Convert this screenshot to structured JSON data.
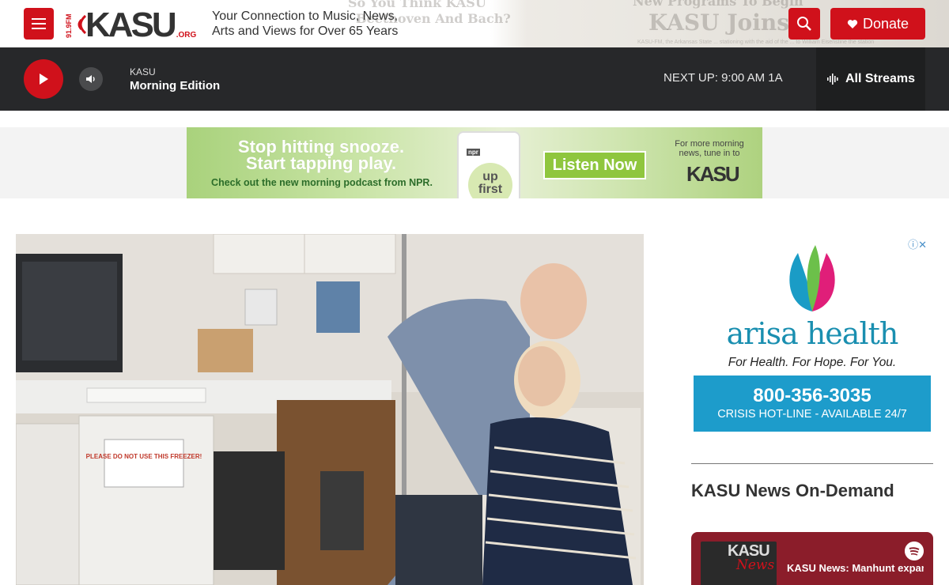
{
  "header": {
    "menu_icon": "hamburger-menu-icon",
    "logo": {
      "frequency": "91.9FM",
      "word": "KASU",
      "suffix": ".ORG"
    },
    "tagline": "Your Connection to Music, News, Arts and Views for Over 65 Years",
    "search_icon": "search-icon",
    "donate_label": "Donate",
    "background_text": [
      "So You Think KASU",
      "Beethoven And Bach?",
      "New Programs To Begin",
      "KASU Joins",
      "KASU-FM, the Arkansas State ... stationing with the aid of the ... to William Eisenstine the station"
    ]
  },
  "player": {
    "station": "KASU",
    "program": "Morning Edition",
    "next_up": "NEXT UP: 9:00 AM 1A",
    "streams_label": "All Streams"
  },
  "banner_ad": {
    "headline_1": "Stop hitting snooze.",
    "headline_2": "Start tapping play.",
    "subhead": "Check out the new morning podcast from NPR.",
    "npr": "npr",
    "podcast_1": "up",
    "podcast_2": "first",
    "cta": "Listen Now",
    "more": "For more morning news, tune in to",
    "station": "KASU",
    "info_icon": "ad-info-icon",
    "close_icon": "ad-close-icon"
  },
  "hero": {
    "freezer_sign": "PLEASE DO NOT USE THIS FREEZER!"
  },
  "side_ad": {
    "brand": "arisa health",
    "tagline": "For Health. For Hope. For You.",
    "phone": "800-356-3035",
    "hotline": "CRISIS HOT-LINE - AVAILABLE 24/7"
  },
  "ondemand": {
    "title": "KASU News On-Demand",
    "art_logo": "KASU",
    "art_word": "News",
    "episode": "KASU News: Manhunt expands",
    "spotify_icon": "spotify-icon"
  },
  "colors": {
    "brand_red": "#d0111b",
    "player_bg": "#27282a",
    "arisa_blue": "#1d9ccb"
  }
}
